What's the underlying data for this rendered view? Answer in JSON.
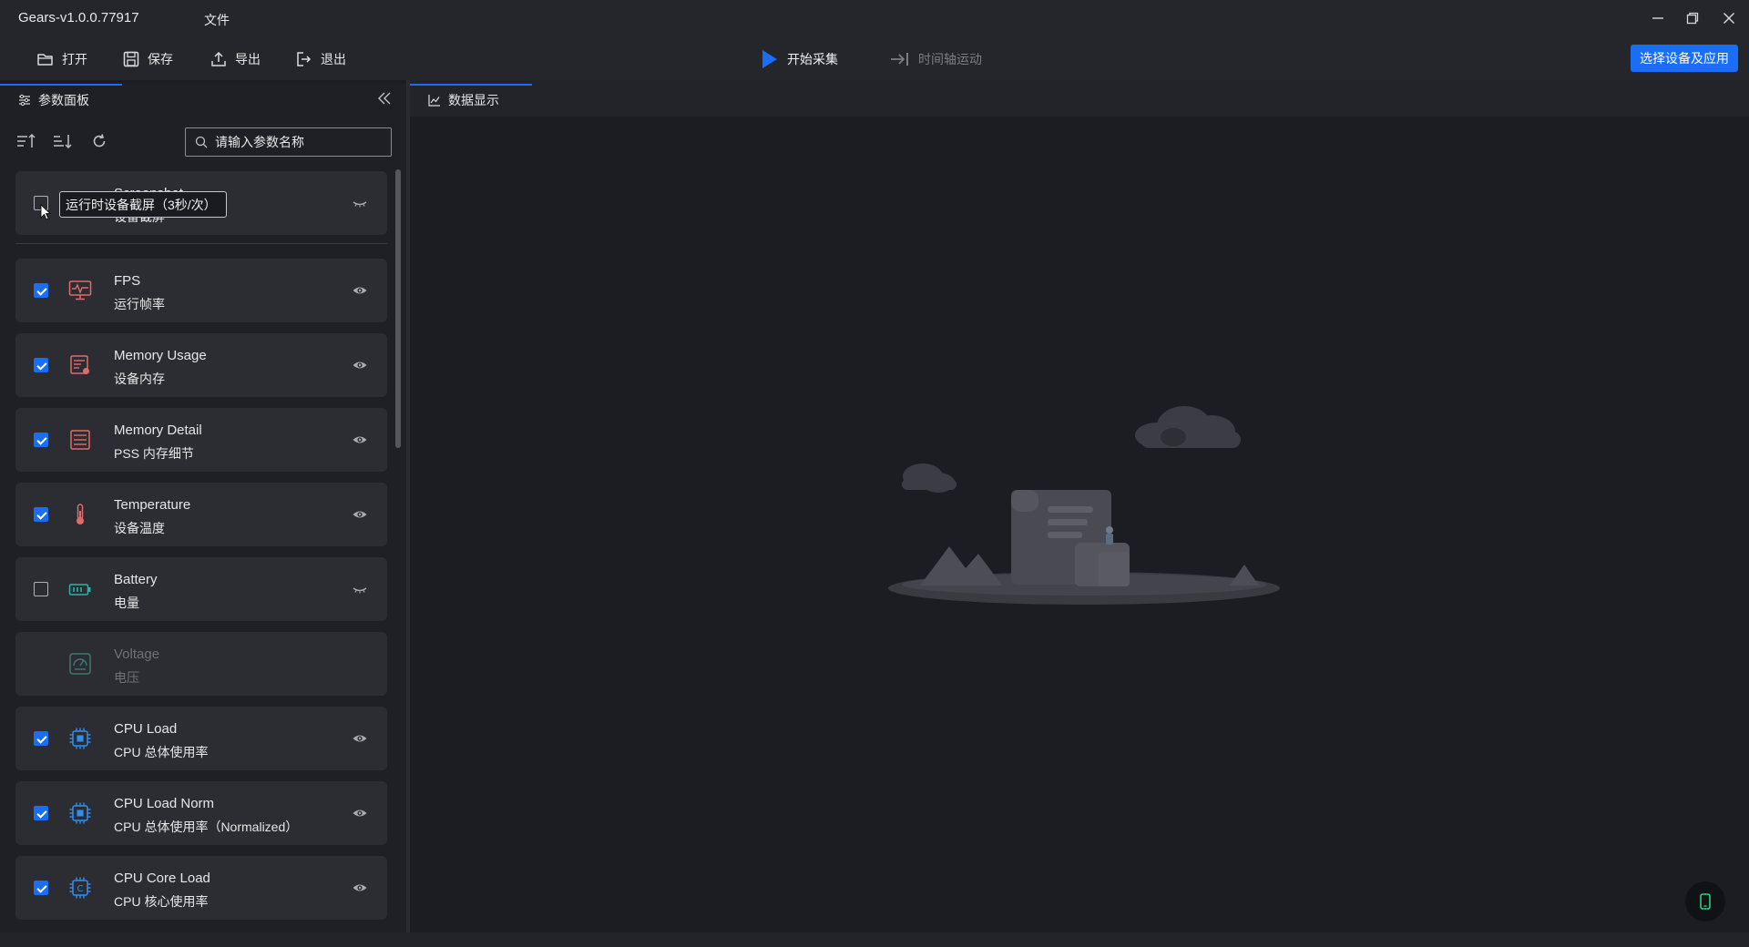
{
  "window": {
    "title": "Gears-v1.0.0.77917",
    "menu_file": "文件"
  },
  "toolbar": {
    "open": "打开",
    "save": "保存",
    "export": "导出",
    "exit": "退出",
    "start_capture": "开始采集",
    "timeline": "时间轴运动",
    "select_device": "选择设备及应用",
    "accent_color": "#1a6df5"
  },
  "left_panel": {
    "tab_label": "参数面板",
    "search_placeholder": "请输入参数名称",
    "tooltip": "运行时设备截屏（3秒/次）",
    "items": [
      {
        "name": "Screenshot",
        "sub": "设备截屏",
        "checked": false,
        "icon": "screenshot-icon",
        "visible": false
      },
      {
        "name": "FPS",
        "sub": "运行帧率",
        "checked": true,
        "icon": "fps-monitor-icon",
        "visible": true
      },
      {
        "name": "Memory Usage",
        "sub": "设备内存",
        "checked": true,
        "icon": "memory-usage-icon",
        "visible": true
      },
      {
        "name": "Memory Detail",
        "sub": "PSS 内存细节",
        "checked": true,
        "icon": "memory-detail-icon",
        "visible": true
      },
      {
        "name": "Temperature",
        "sub": "设备温度",
        "checked": true,
        "icon": "thermometer-icon",
        "visible": true
      },
      {
        "name": "Battery",
        "sub": "电量",
        "checked": false,
        "icon": "battery-icon",
        "visible": false
      },
      {
        "name": "Voltage",
        "sub": "电压",
        "checked": false,
        "icon": "voltage-gauge-icon",
        "disabled": true
      },
      {
        "name": "CPU Load",
        "sub": "CPU 总体使用率",
        "checked": true,
        "icon": "cpu-icon",
        "visible": true
      },
      {
        "name": "CPU Load Norm",
        "sub": "CPU 总体使用率（Normalized）",
        "checked": true,
        "icon": "cpu-icon",
        "visible": true
      },
      {
        "name": "CPU Core Load",
        "sub": "CPU 核心使用率",
        "checked": true,
        "icon": "cpu-core-icon",
        "visible": true
      }
    ]
  },
  "right_panel": {
    "tab_label": "数据显示"
  }
}
